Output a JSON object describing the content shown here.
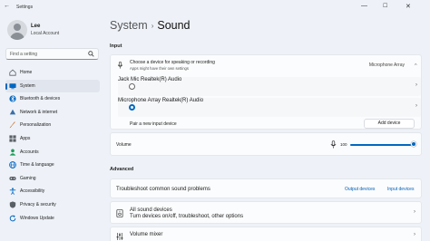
{
  "window": {
    "title": "Settings"
  },
  "profile": {
    "name": "Lee",
    "account": "Local Account"
  },
  "search": {
    "placeholder": "Find a setting"
  },
  "nav": {
    "items": [
      {
        "label": "Home",
        "icon": "home-icon",
        "color": "#5a5f66"
      },
      {
        "label": "System",
        "icon": "system-icon",
        "color": "#0067c0"
      },
      {
        "label": "Bluetooth & devices",
        "icon": "bluetooth-icon",
        "color": "#0067c0"
      },
      {
        "label": "Network & internet",
        "icon": "network-icon",
        "color": "#3b6ea8"
      },
      {
        "label": "Personalization",
        "icon": "brush-icon",
        "color": "#c86b1f"
      },
      {
        "label": "Apps",
        "icon": "apps-icon",
        "color": "#5a5f66"
      },
      {
        "label": "Accounts",
        "icon": "accounts-icon",
        "color": "#1e9e5a"
      },
      {
        "label": "Time & language",
        "icon": "globe-icon",
        "color": "#0067c0"
      },
      {
        "label": "Gaming",
        "icon": "gaming-icon",
        "color": "#5a5f66"
      },
      {
        "label": "Accessibility",
        "icon": "accessibility-icon",
        "color": "#0067c0"
      },
      {
        "label": "Privacy & security",
        "icon": "shield-icon",
        "color": "#5a5f66"
      },
      {
        "label": "Windows Update",
        "icon": "update-icon",
        "color": "#0067c0"
      }
    ],
    "active_index": 1
  },
  "page": {
    "crumb": "System",
    "separator": "›",
    "current": "Sound"
  },
  "input": {
    "heading": "Input",
    "choose": {
      "title": "Choose a device for speaking or recording",
      "subtitle": "Apps might have their own settings",
      "value": "Microphone Array"
    },
    "devices": [
      {
        "name": "Jack Mic",
        "driver": "Realtek(R) Audio",
        "selected": false
      },
      {
        "name": "Microphone Array",
        "driver": "Realtek(R) Audio",
        "selected": true
      }
    ],
    "pair": {
      "label": "Pair a new input device",
      "button": "Add device"
    },
    "volume": {
      "label": "Volume",
      "value": "100",
      "level": 1.0
    }
  },
  "advanced": {
    "heading": "Advanced",
    "troubleshoot": {
      "label": "Troubleshoot common sound problems",
      "link1": "Output devices",
      "link2": "Input devices"
    },
    "all_devices": {
      "title": "All sound devices",
      "subtitle": "Turn devices on/off, troubleshoot, other options"
    },
    "mixer": {
      "title": "Volume mixer"
    }
  },
  "colors": {
    "accent": "#0067c0",
    "link": "#005fb8"
  }
}
